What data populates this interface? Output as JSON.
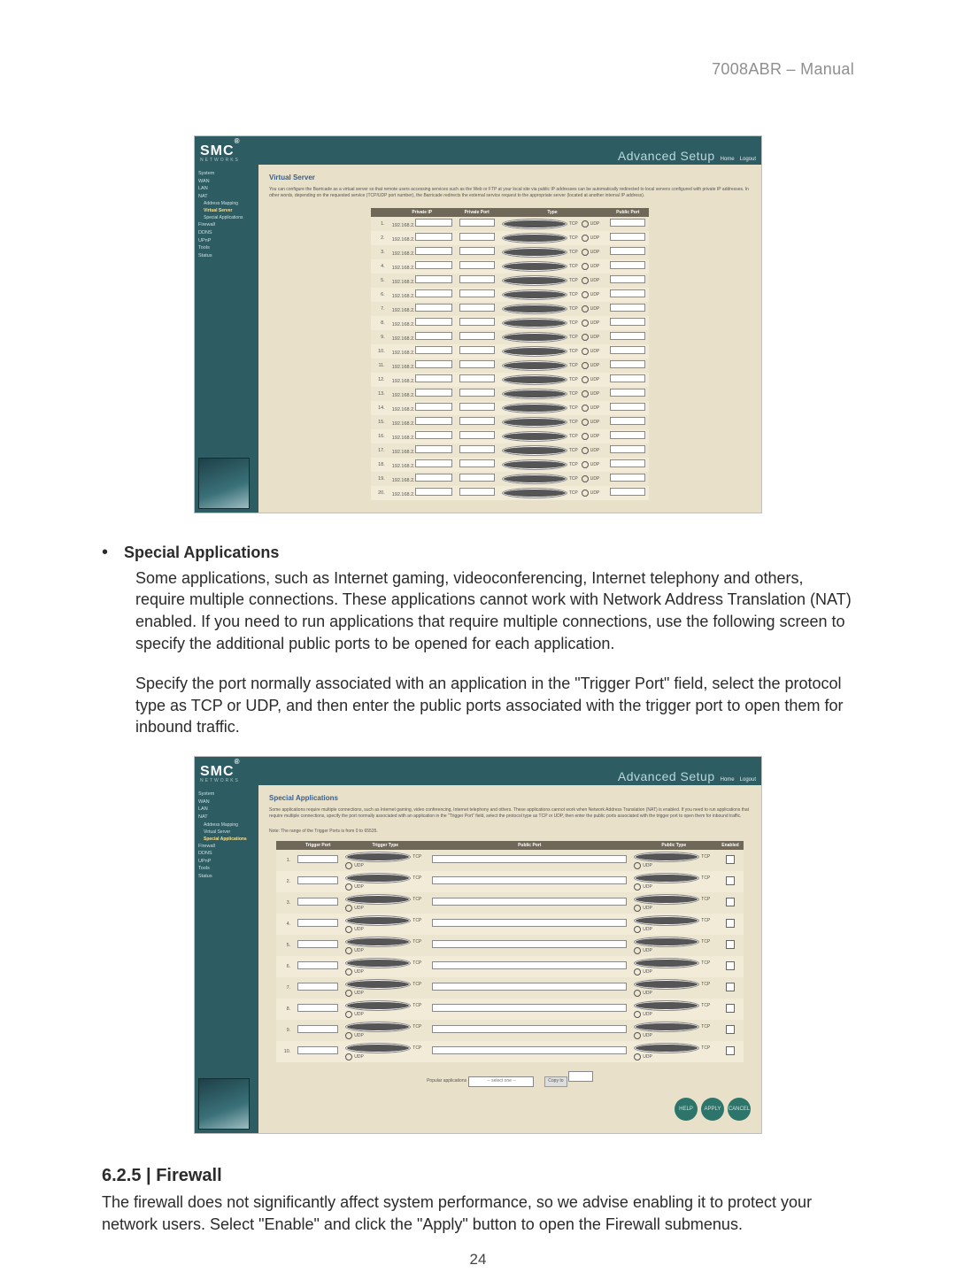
{
  "doc_header": "7008ABR – Manual",
  "page_number": "24",
  "brand": {
    "name": "SMC",
    "reg": "®",
    "sub": "NETWORKS"
  },
  "adv_setup": "Advanced Setup",
  "top_links": [
    "Home",
    "Logout"
  ],
  "sidebar_vs": [
    "System",
    "WAN",
    "LAN",
    "NAT",
    "Address Mapping",
    "Virtual Server",
    "Special Applications",
    "Firewall",
    "DDNS",
    "UPnP",
    "Tools",
    "Status"
  ],
  "vs_highlight_index": 5,
  "vs_title": "Virtual Server",
  "vs_desc": "You can configure the Barricade as a virtual server so that remote users accessing services such as the Web or FTP at your local site via public IP addresses can be automatically redirected to local servers configured with private IP addresses. In other words, depending on the requested service (TCP/UDP port number), the Barricade redirects the external service request to the appropriate server (located at another internal IP address).",
  "vs_headers": [
    "",
    "Private IP",
    "Private Port",
    "Type",
    "Public Port"
  ],
  "vs_ip_prefix": "192.168.2.",
  "radio_tcp": "TCP",
  "radio_udp": "UDP",
  "vs_rows": 20,
  "sa_bullet_title": "Special Applications",
  "sa_para1": "Some applications, such as Internet gaming, videoconferencing, Internet telephony and others, require multiple connections. These applications cannot work with Network Address Translation (NAT) enabled. If you need to run applications that require multiple connections, use the following screen to specify the additional public ports to be opened for each application.",
  "sa_para2": "Specify the port normally associated with an application in the \"Trigger Port\" field, select the protocol type as TCP or UDP, and then enter the public ports associated with the trigger port to open them for inbound traffic.",
  "sidebar_sa": [
    "System",
    "WAN",
    "LAN",
    "NAT",
    "Address Mapping",
    "Virtual Server",
    "Special Applications",
    "Firewall",
    "DDNS",
    "UPnP",
    "Tools",
    "Status"
  ],
  "sa_highlight_index": 6,
  "sa_title": "Special Applications",
  "sa_desc": "Some applications require multiple connections, such as Internet gaming, video conferencing, Internet telephony and others. These applications cannot work when Network Address Translation (NAT) is enabled. If you need to run applications that require multiple connections, specify the port normally associated with an application in the \"Trigger Port\" field, select the protocol type as TCP or UDP, then enter the public ports associated with the trigger port to open them for inbound traffic.",
  "sa_note": "Note: The range of the Trigger Ports is from 0 to 65535.",
  "sa_headers": [
    "",
    "Trigger Port",
    "Trigger Type",
    "Public Port",
    "Public Type",
    "Enabled"
  ],
  "sa_rows": 10,
  "popular_label": "Popular applications",
  "popular_sel": "-- select one --",
  "copy_to": "Copy to",
  "btns": [
    "HELP",
    "APPLY",
    "CANCEL"
  ],
  "fw_heading": "6.2.5 | Firewall",
  "fw_para": "The firewall does not significantly affect system performance, so we advise enabling it to protect your network users. Select \"Enable\" and click the \"Apply\" button to open the Firewall submenus."
}
